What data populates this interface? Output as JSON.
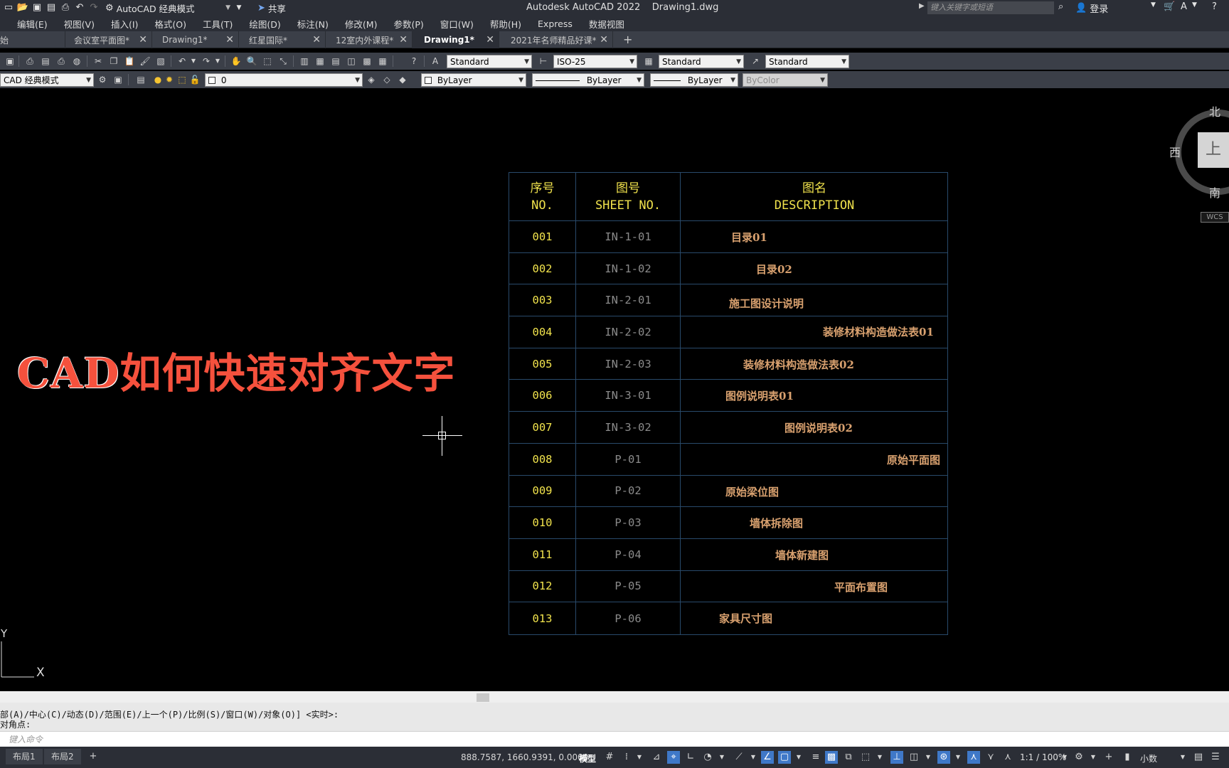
{
  "titlebar": {
    "workspace": "AutoCAD 经典模式",
    "share": "共享",
    "app_title": "Autodesk AutoCAD 2022    Drawing1.dwg",
    "search_placeholder": "键入关键字或短语",
    "login": "登录"
  },
  "menu": [
    "编辑(E)",
    "视图(V)",
    "插入(I)",
    "格式(O)",
    "工具(T)",
    "绘图(D)",
    "标注(N)",
    "修改(M)",
    "参数(P)",
    "窗口(W)",
    "帮助(H)",
    "Express",
    "数据视图"
  ],
  "tabs": [
    {
      "label": "始",
      "active": false
    },
    {
      "label": "会议室平面图*",
      "active": false
    },
    {
      "label": "Drawing1*",
      "active": false
    },
    {
      "label": "红星国际*",
      "active": false
    },
    {
      "label": "12室内外课程*",
      "active": false
    },
    {
      "label": "Drawing1*",
      "active": true
    },
    {
      "label": "2021年名师精品好课*",
      "active": false
    }
  ],
  "styles": {
    "text_style": "Standard",
    "dim_style": "ISO-25",
    "table_style": "Standard",
    "multileader_style": "Standard"
  },
  "layers": {
    "workspace": "CAD 经典模式",
    "layer": "0",
    "color": "ByLayer",
    "linetype": "ByLayer",
    "lineweight": "ByLayer",
    "plotstyle": "ByColor"
  },
  "overlay_title": {
    "latin": "CAD",
    "cjk": "如何快速对齐文字"
  },
  "table": {
    "headers": [
      {
        "cn": "序号",
        "en": "NO."
      },
      {
        "cn": "图号",
        "en": "SHEET NO."
      },
      {
        "cn": "图名",
        "en": "DESCRIPTION"
      }
    ],
    "rows": [
      {
        "no": "001",
        "sheet": "IN-1-01",
        "desc": "目录01"
      },
      {
        "no": "002",
        "sheet": "IN-1-02",
        "desc": "目录02"
      },
      {
        "no": "003",
        "sheet": "IN-2-01",
        "desc": "施工图设计说明"
      },
      {
        "no": "004",
        "sheet": "IN-2-02",
        "desc": "装修材料构造做法表01"
      },
      {
        "no": "005",
        "sheet": "IN-2-03",
        "desc": "装修材料构造做法表02"
      },
      {
        "no": "006",
        "sheet": "IN-3-01",
        "desc": "图例说明表01"
      },
      {
        "no": "007",
        "sheet": "IN-3-02",
        "desc": "图例说明表02"
      },
      {
        "no": "008",
        "sheet": "P-01",
        "desc": "原始平面图"
      },
      {
        "no": "009",
        "sheet": "P-02",
        "desc": "原始梁位图"
      },
      {
        "no": "010",
        "sheet": "P-03",
        "desc": "墙体拆除图"
      },
      {
        "no": "011",
        "sheet": "P-04",
        "desc": "墙体新建图"
      },
      {
        "no": "012",
        "sheet": "P-05",
        "desc": "平面布置图"
      },
      {
        "no": "013",
        "sheet": "P-06",
        "desc": "家具尺寸图"
      }
    ]
  },
  "viewcube": {
    "north": "北",
    "south": "南",
    "west": "西",
    "face": "上",
    "wcs": "WCS"
  },
  "ucs": {
    "x": "X",
    "y": "Y"
  },
  "command": {
    "history_1": "部(A)/中心(C)/动态(D)/范围(E)/上一个(P)/比例(S)/窗口(W)/对象(O)] <实时>:",
    "history_2": "对角点:",
    "input_placeholder": "键入命令"
  },
  "status": {
    "layout_tabs": [
      "布局1",
      "布局2"
    ],
    "coords": "888.7587, 1660.9391, 0.0000",
    "model": "模型",
    "scale": "1:1 / 100%",
    "units": "小数"
  }
}
